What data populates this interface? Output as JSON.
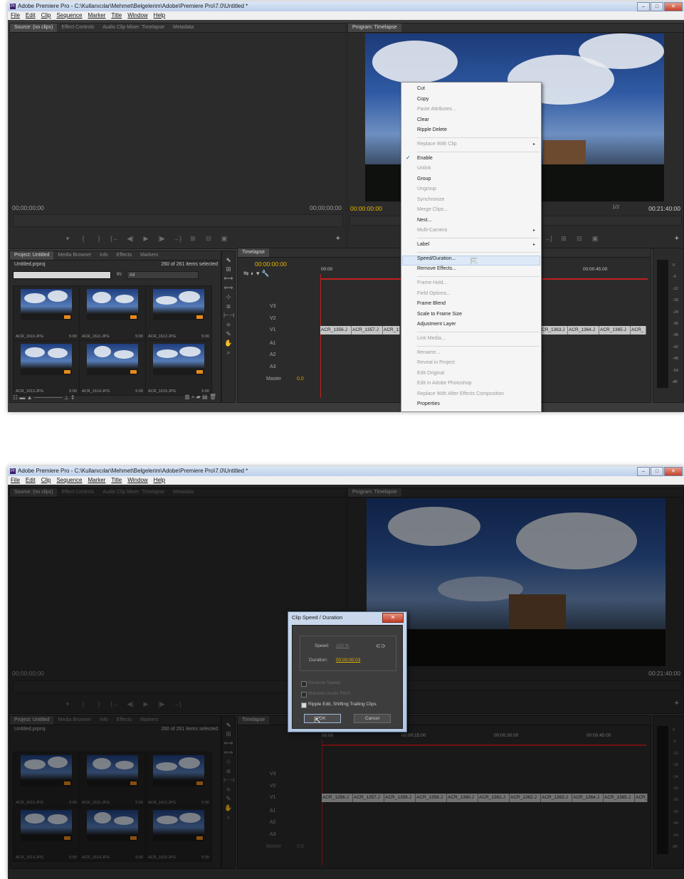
{
  "window": {
    "title": "Adobe Premiere Pro - C:\\Kullanıcılar\\Mehmet\\Belgelerim\\Adobe\\Premiere Pro\\7.0\\Untitled *",
    "min": "–",
    "max": "□",
    "close": "✕"
  },
  "menu": [
    "File",
    "Edit",
    "Clip",
    "Sequence",
    "Marker",
    "Title",
    "Window",
    "Help"
  ],
  "source_panel": {
    "tabs": [
      "Source: (no clips)",
      "Effect Controls",
      "Audio Clip Mixer: Timelapse",
      "Metadata"
    ],
    "timecode_left": "00;00;00;00",
    "timecode_right": "00;00;00;00"
  },
  "program_panel": {
    "tab": "Program: Timelapse",
    "timecode": "00:00:00:00",
    "zoom": "1/2",
    "duration": "00:21:40:00"
  },
  "project_panel": {
    "tabs": [
      "Project: Untitled",
      "Media Browser",
      "Info",
      "Effects",
      "Markers"
    ],
    "file": "Untitled.prproj",
    "selection": "260 of 261 items selected",
    "in_label": "In:",
    "in_value": "All",
    "items": [
      {
        "name": "ACR_1610.JPG",
        "duration": "5:00"
      },
      {
        "name": "ACR_1611.JPG",
        "duration": "5:00"
      },
      {
        "name": "ACR_1612.JPG",
        "duration": "5:00"
      },
      {
        "name": "ACR_1613.JPG",
        "duration": "5:00"
      },
      {
        "name": "ACR_1614.JPG",
        "duration": "5:00"
      },
      {
        "name": "ACR_1615.JPG",
        "duration": "5:00"
      }
    ]
  },
  "timeline": {
    "tab": "Timelapse",
    "timecode": "00:00:00:00",
    "ruler": [
      "00:00",
      "00:00:15:00",
      "00:00:30:00",
      "00:00:45:00"
    ],
    "video_tracks": [
      "V3",
      "V2",
      "V1"
    ],
    "audio_tracks": [
      "A1",
      "A2",
      "A3"
    ],
    "master": "Master",
    "master_value": "0,0",
    "clips": [
      "ACR_1356.J",
      "ACR_1357.J",
      "ACR_1358.J",
      "ACR_1359.J",
      "ACR_1360.J",
      "ACR_1361.J",
      "ACR_1362.J",
      "ACR_1363.J",
      "ACR_1364.J",
      "ACR_1365.J",
      "ACR_"
    ],
    "clips_a": [
      "ACR_1356.J",
      "ACR_1357.J",
      "ACR_13"
    ],
    "clips_a_right": [
      "CR_1363.J",
      "ACR_1364.J",
      "ACR_1365.J",
      "ACR_"
    ]
  },
  "meter_labels": [
    "0",
    "-6",
    "-12",
    "-18",
    "-24",
    "-30",
    "-36",
    "-42",
    "-48",
    "-54",
    "dB"
  ],
  "context_menu": [
    {
      "label": "Cut",
      "enabled": true
    },
    {
      "label": "Copy",
      "enabled": true
    },
    {
      "label": "Paste Attributes...",
      "enabled": false
    },
    {
      "label": "Clear",
      "enabled": true
    },
    {
      "label": "Ripple Delete",
      "enabled": true
    },
    {
      "sep": true
    },
    {
      "label": "Replace With Clip",
      "enabled": false,
      "submenu": true
    },
    {
      "sep": true
    },
    {
      "label": "Enable",
      "enabled": true,
      "checked": true
    },
    {
      "label": "Unlink",
      "enabled": false
    },
    {
      "label": "Group",
      "enabled": true
    },
    {
      "label": "Ungroup",
      "enabled": false
    },
    {
      "label": "Synchronize",
      "enabled": false
    },
    {
      "label": "Merge Clips...",
      "enabled": false
    },
    {
      "label": "Nest...",
      "enabled": true
    },
    {
      "label": "Multi-Camera",
      "enabled": false,
      "submenu": true
    },
    {
      "sep": true
    },
    {
      "label": "Label",
      "enabled": true,
      "submenu": true
    },
    {
      "sep": true
    },
    {
      "label": "Speed/Duration...",
      "enabled": true,
      "highlighted": true
    },
    {
      "label": "Remove Effects...",
      "enabled": true
    },
    {
      "sep": true
    },
    {
      "label": "Frame Hold...",
      "enabled": false
    },
    {
      "label": "Field Options...",
      "enabled": false
    },
    {
      "label": "Frame Blend",
      "enabled": true
    },
    {
      "label": "Scale to Frame Size",
      "enabled": true
    },
    {
      "label": "Adjustment Layer",
      "enabled": true
    },
    {
      "sep": true
    },
    {
      "label": "Link Media...",
      "enabled": false
    },
    {
      "sep": true
    },
    {
      "label": "Rename...",
      "enabled": false
    },
    {
      "label": "Reveal in Project",
      "enabled": false
    },
    {
      "label": "Edit Original",
      "enabled": false
    },
    {
      "label": "Edit in Adobe Photoshop",
      "enabled": false
    },
    {
      "label": "Replace With After Effects Composition",
      "enabled": false
    },
    {
      "label": "Properties",
      "enabled": true
    }
  ],
  "dialog": {
    "title": "Clip Speed / Duration",
    "close": "✕",
    "speed_label": "Speed:",
    "speed_value": "100 %",
    "duration_label": "Duration:",
    "duration_value": "00:00:00:03",
    "reverse": "Reverse Speed",
    "maintain": "Maintain Audio Pitch",
    "ripple": "Ripple Edit, Shifting Trailing Clips",
    "ok": "OK",
    "cancel": "Cancel"
  },
  "colors": {
    "panel_bg": "#2b2b2b",
    "timecode_yellow": "#e4b400",
    "playhead_red": "#c0201e",
    "clip_gray": "#c6c6c6",
    "selection_blue": "#dde9f7"
  }
}
